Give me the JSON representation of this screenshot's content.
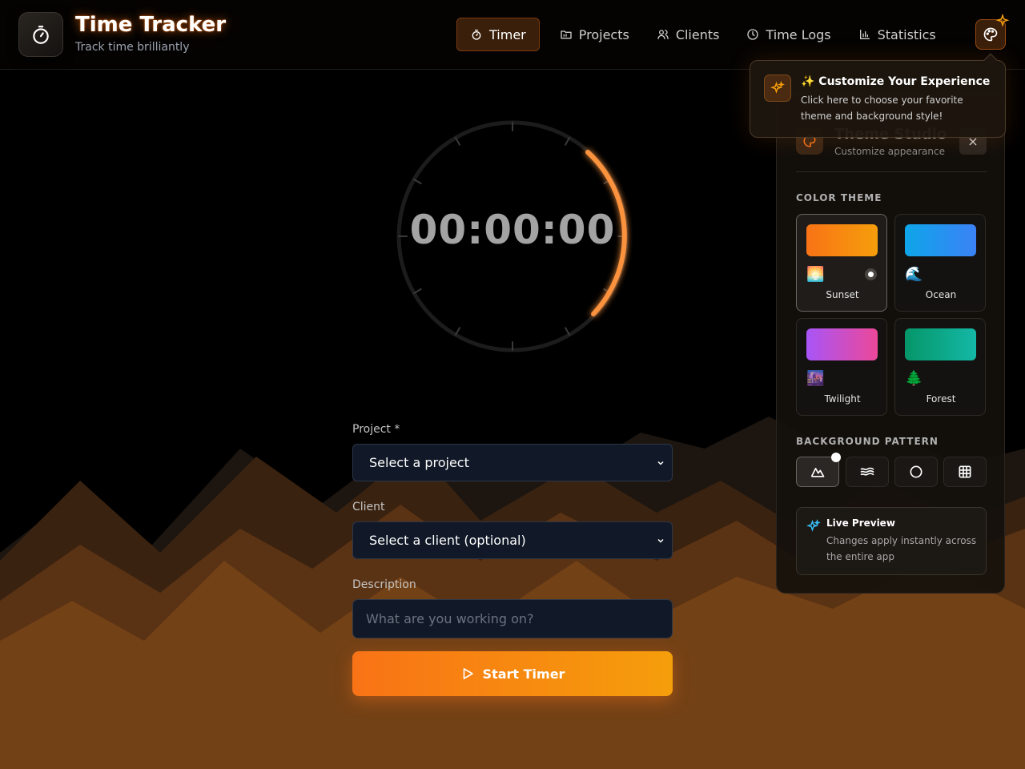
{
  "header": {
    "title": "Time Tracker",
    "subtitle": "Track time brilliantly"
  },
  "nav": {
    "items": [
      {
        "label": "Timer",
        "icon": "stopwatch-icon",
        "active": true
      },
      {
        "label": "Projects",
        "icon": "folder-icon"
      },
      {
        "label": "Clients",
        "icon": "users-icon"
      },
      {
        "label": "Time Logs",
        "icon": "clock-icon"
      },
      {
        "label": "Statistics",
        "icon": "bar-chart-icon"
      }
    ]
  },
  "timer": {
    "display": "00:00:00"
  },
  "form": {
    "project_label": "Project *",
    "project_value": "Select a project",
    "client_label": "Client",
    "client_value": "Select a client (optional)",
    "description_label": "Description",
    "description_placeholder": "What are you working on?",
    "start_label": "Start Timer"
  },
  "tooltip": {
    "title": "✨ Customize Your Experience",
    "text": "Click here to choose your favorite theme and background style!"
  },
  "theme_panel": {
    "title": "Theme Studio",
    "subtitle": "Customize appearance",
    "close_symbol": "×",
    "color_theme_label": "COLOR THEME",
    "themes": [
      {
        "name": "Sunset",
        "emoji": "🌅",
        "selected": true
      },
      {
        "name": "Ocean",
        "emoji": "🌊"
      },
      {
        "name": "Twilight",
        "emoji": "🌆"
      },
      {
        "name": "Forest",
        "emoji": "🌲"
      }
    ],
    "background_pattern_label": "BACKGROUND PATTERN",
    "patterns": [
      {
        "icon": "mountain-icon",
        "selected": true
      },
      {
        "icon": "waves-icon"
      },
      {
        "icon": "circle-icon"
      },
      {
        "icon": "grid-icon"
      }
    ],
    "live_preview_title": "Live Preview",
    "live_preview_text": "Changes apply instantly across the entire app"
  },
  "colors": {
    "accent": "#f97316",
    "accent_secondary": "#f59e0b",
    "background": "#000000"
  }
}
